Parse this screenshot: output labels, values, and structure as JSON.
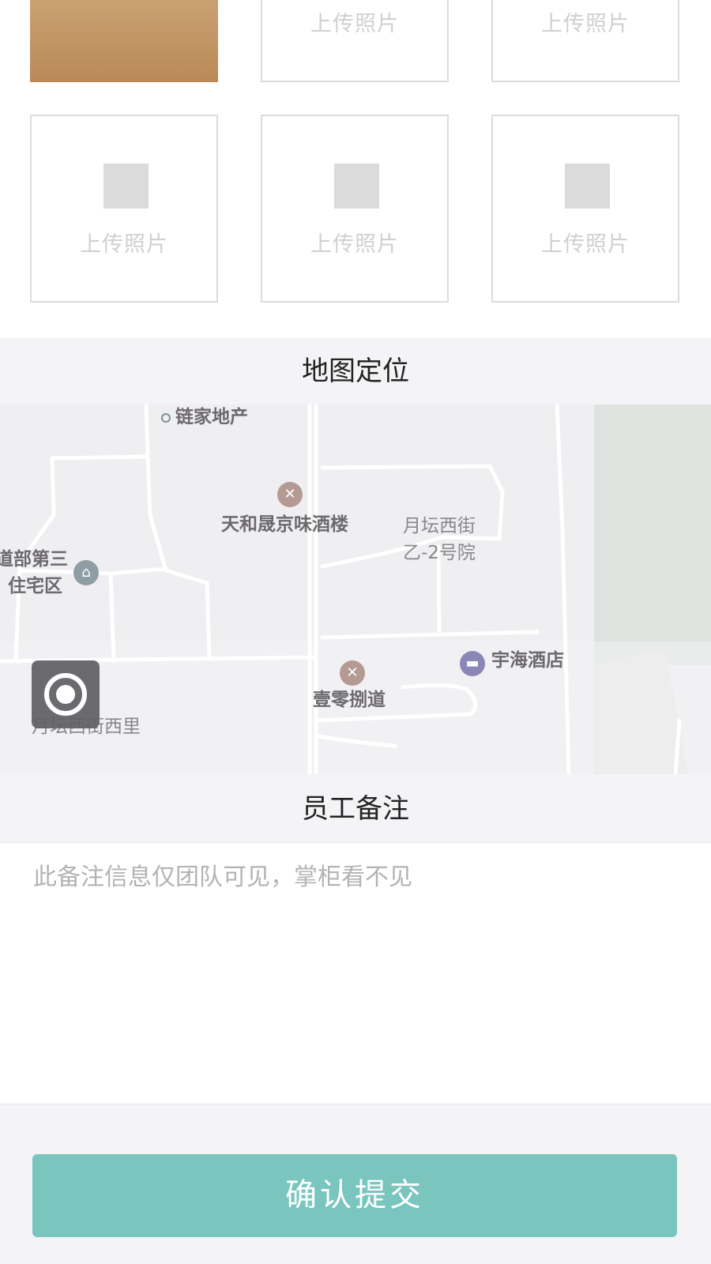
{
  "photos": {
    "upload_label": "上传照片",
    "slots": [
      {
        "state": "filled"
      },
      {
        "state": "empty",
        "label": "上传照片"
      },
      {
        "state": "empty",
        "label": "上传照片"
      },
      {
        "state": "empty",
        "label": "上传照片"
      },
      {
        "state": "empty",
        "label": "上传照片"
      },
      {
        "state": "empty",
        "label": "上传照片"
      }
    ]
  },
  "map_section": {
    "title": "地图定位",
    "labels": {
      "lianjia": "链家地产",
      "tianhe": "天和晟京味酒楼",
      "yuetan_1": "月坛西街",
      "yuetan_2": "乙-2号院",
      "residential_1": "道部第三",
      "residential_2": "住宅区",
      "yuhai": "宇海酒店",
      "yiling": "壹零捌道",
      "yuetan_xili": "月坛西街西里"
    },
    "icons": {
      "restaurant": "restaurant-icon",
      "hotel": "hotel-icon",
      "residence": "residence-icon",
      "locate": "locate-icon"
    }
  },
  "notes_section": {
    "title": "员工备注",
    "placeholder": "此备注信息仅团队可见，掌柜看不见",
    "value": ""
  },
  "submit": {
    "label": "确认提交"
  },
  "colors": {
    "accent": "#7bc5bf",
    "background": "#f4f3f6",
    "map_bg": "#efeef0",
    "poi_restaurant": "#b59a94",
    "poi_hotel": "#8a86b8",
    "poi_residence": "#8e9ea4"
  }
}
